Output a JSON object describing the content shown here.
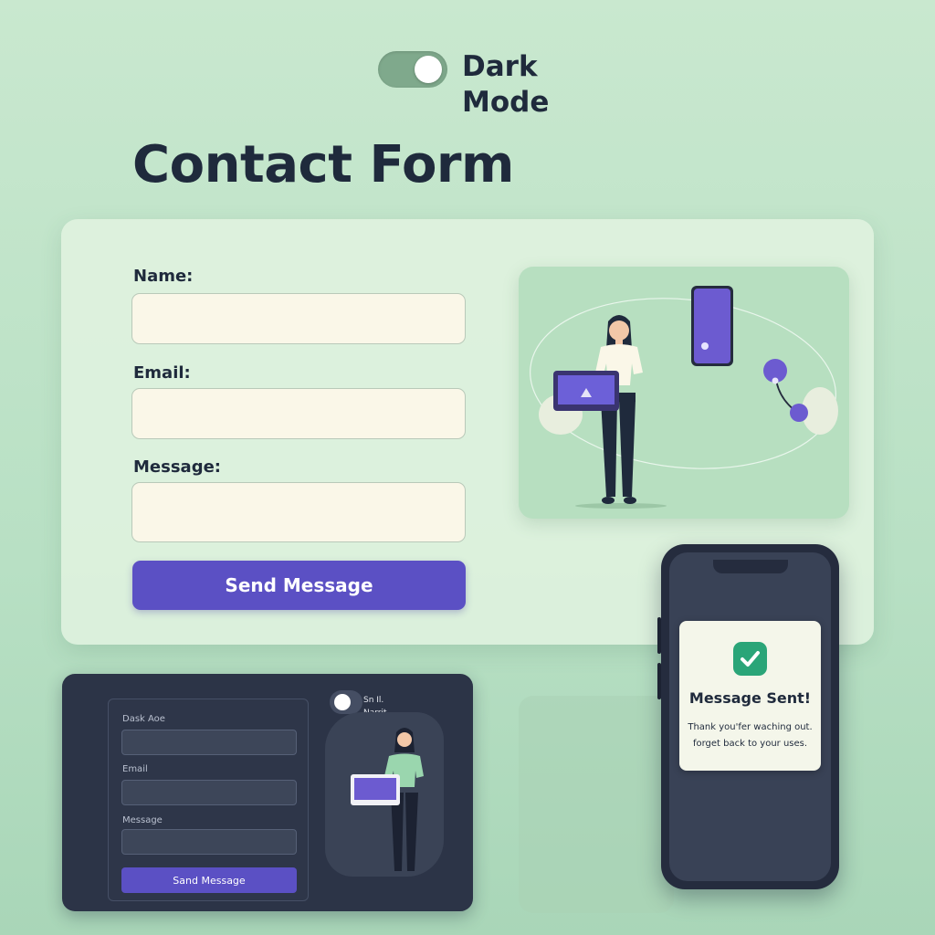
{
  "toggle": {
    "label": "Dark Mode",
    "checked": true
  },
  "page": {
    "title": "Contact Form"
  },
  "form": {
    "name_label": "Name:",
    "email_label": "Email:",
    "message_label": "Message:",
    "name_value": "",
    "email_value": "",
    "message_value": "",
    "submit_label": "Send Message"
  },
  "dark_preview": {
    "name_label": "Dask Aoe",
    "email_label": "Email",
    "message_label": "Message",
    "submit_label": "Sand Message",
    "toggle_label_1": "Sn Il.",
    "toggle_label_2": "Narrit"
  },
  "toast": {
    "title": "Message Sent!",
    "line1": "Thank you'fer waching out.",
    "line2": "forget back to your uses."
  },
  "colors": {
    "background": "#c4e6cc",
    "accent": "#5b50c4",
    "text": "#1f2a3c",
    "success": "#2aa578",
    "dark_panel": "#2c3447"
  },
  "icons": [
    "check-icon",
    "laptop-icon",
    "smartphone-icon",
    "location-pin-icon"
  ]
}
